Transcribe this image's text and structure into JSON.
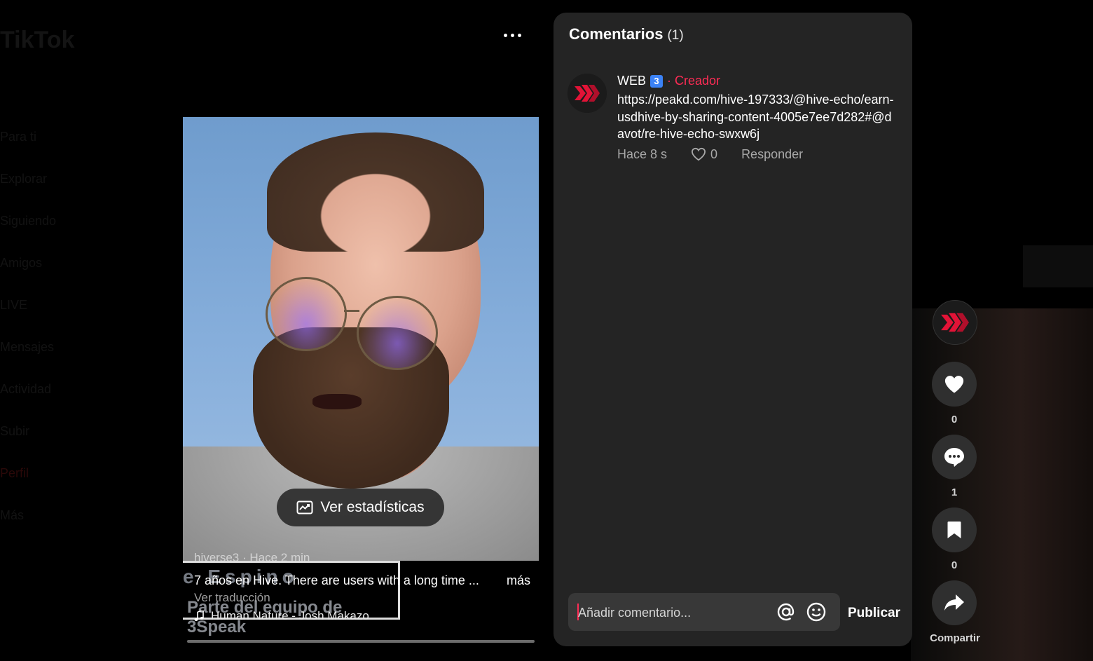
{
  "sidebar": {
    "logo": "TikTok",
    "items": [
      "Para ti",
      "Explorar",
      "Siguiendo",
      "Amigos",
      "LIVE",
      "Mensajes",
      "Actividad",
      "Subir",
      "Perfil",
      "Más"
    ]
  },
  "video": {
    "stats_button": "Ver estadísticas",
    "overlay_name": "e Espino",
    "overlay_subtitle": "Parte del equipo de 3Speak",
    "author_line": "hiverse3 · Hace 2 min",
    "description": "7 años en Hive. There are users with a long time ...",
    "more_label": "más",
    "translate_label": "Ver traducción",
    "music": "Human Nature - Josh Makazo"
  },
  "comments": {
    "title": "Comentarios",
    "count": "(1)",
    "items": [
      {
        "user": "WEB",
        "badge": "3",
        "creator_label": "· Creador",
        "text": "https://peakd.com/hive-197333/@hive-echo/earn-usdhive-by-sharing-content-4005e7ee7d282#@davot/re-hive-echo-swxw6j",
        "time": "Hace 8 s",
        "likes": "0",
        "reply_label": "Responder"
      }
    ],
    "input_placeholder": "Añadir comentario...",
    "publish_label": "Publicar"
  },
  "actions": {
    "likes": "0",
    "comments": "1",
    "saves": "0",
    "share_label": "Compartir"
  },
  "colors": {
    "accent": "#fe2c55",
    "panel": "#242424",
    "hive_red": "#e31337"
  }
}
